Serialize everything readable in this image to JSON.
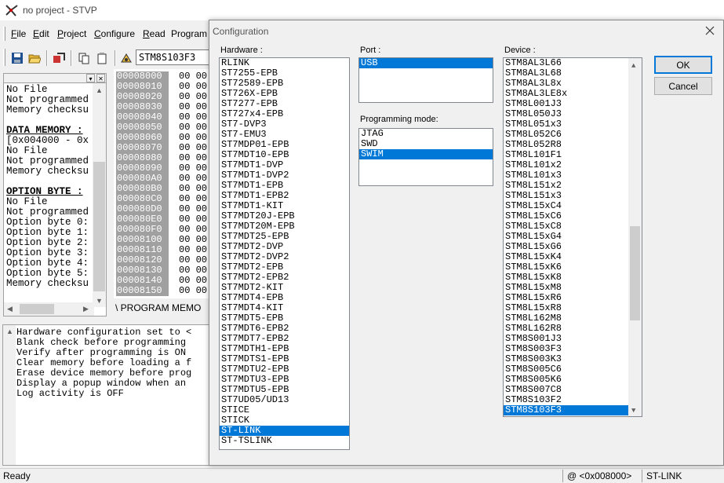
{
  "window": {
    "title": "no project - STVP"
  },
  "menu": {
    "items": [
      {
        "accel": "F",
        "rest": "ile"
      },
      {
        "accel": "E",
        "rest": "dit"
      },
      {
        "accel": "P",
        "rest": "roject"
      },
      {
        "accel": "C",
        "rest": "onfigure"
      },
      {
        "accel": "R",
        "rest": "ead"
      },
      {
        "accel": "",
        "rest": "Program"
      }
    ]
  },
  "toolbar": {
    "device": "STM8S103F3"
  },
  "info_panel": {
    "lines": [
      {
        "text": "No File",
        "bold": false
      },
      {
        "text": "Not programmed",
        "bold": false
      },
      {
        "text": "Memory checksu",
        "bold": false
      },
      {
        "text": "",
        "bold": false
      },
      {
        "text": "DATA MEMORY :",
        "bold": true
      },
      {
        "text": "[0x004000 - 0x",
        "bold": false
      },
      {
        "text": "No File",
        "bold": false
      },
      {
        "text": "Not programmed",
        "bold": false
      },
      {
        "text": "Memory checksu",
        "bold": false
      },
      {
        "text": "",
        "bold": false
      },
      {
        "text": "OPTION BYTE :",
        "bold": true
      },
      {
        "text": "No File",
        "bold": false
      },
      {
        "text": "Not programmed",
        "bold": false
      },
      {
        "text": "Option byte 0:",
        "bold": false
      },
      {
        "text": "Option byte 1:",
        "bold": false
      },
      {
        "text": "Option byte 2:",
        "bold": false
      },
      {
        "text": "Option byte 3:",
        "bold": false
      },
      {
        "text": "Option byte 4:",
        "bold": false
      },
      {
        "text": "Option byte 5:",
        "bold": false
      },
      {
        "text": "Memory checksu",
        "bold": false
      }
    ]
  },
  "memory": {
    "addresses": [
      "00008000",
      "00008010",
      "00008020",
      "00008030",
      "00008040",
      "00008050",
      "00008060",
      "00008070",
      "00008080",
      "00008090",
      "000080A0",
      "000080B0",
      "000080C0",
      "000080D0",
      "000080E0",
      "000080F0",
      "00008100",
      "00008110",
      "00008120",
      "00008130",
      "00008140",
      "00008150"
    ],
    "data": [
      "00 00",
      "00 00",
      "00 00",
      "00 00",
      "00 00",
      "00 00",
      "00 00",
      "00 00",
      "00 00",
      "00 00",
      "00 00",
      "00 00",
      "00 00",
      "00 00",
      "00 00",
      "00 00",
      "00 00",
      "00 00",
      "00 00",
      "00 00",
      "00 00",
      "00 00"
    ],
    "tab_label": "\\ PROGRAM MEMO"
  },
  "log": {
    "lines": [
      "Hardware configuration set to <",
      "Blank check before programming",
      "Verify after programming is ON",
      "Clear memory before loading a f",
      "Erase device memory before prog",
      "Display a popup window when an",
      "Log activity is OFF"
    ]
  },
  "statusbar": {
    "status": "Ready",
    "address": "@ <0x008000>",
    "hardware": "ST-LINK"
  },
  "dialog": {
    "title": "Configuration",
    "hardware_label": "Hardware :",
    "hardware_items": [
      "RLINK",
      "ST7255-EPB",
      "ST72589-EPB",
      "ST726X-EPB",
      "ST7277-EPB",
      "ST727x4-EPB",
      "ST7-DVP3",
      "ST7-EMU3",
      "ST7MDP01-EPB",
      "ST7MDT10-EPB",
      "ST7MDT1-DVP",
      "ST7MDT1-DVP2",
      "ST7MDT1-EPB",
      "ST7MDT1-EPB2",
      "ST7MDT1-KIT",
      "ST7MDT20J-EPB",
      "ST7MDT20M-EPB",
      "ST7MDT25-EPB",
      "ST7MDT2-DVP",
      "ST7MDT2-DVP2",
      "ST7MDT2-EPB",
      "ST7MDT2-EPB2",
      "ST7MDT2-KIT",
      "ST7MDT4-EPB",
      "ST7MDT4-KIT",
      "ST7MDT5-EPB",
      "ST7MDT6-EPB2",
      "ST7MDT7-EPB2",
      "ST7MDTH1-EPB",
      "ST7MDTS1-EPB",
      "ST7MDTU2-EPB",
      "ST7MDTU3-EPB",
      "ST7MDTU5-EPB",
      "ST7UD05/UD13",
      "STICE",
      "STICK",
      "ST-LINK",
      "ST-TSLINK"
    ],
    "hardware_selected": "ST-LINK",
    "port_label": "Port :",
    "port_items": [
      "USB"
    ],
    "port_selected": "USB",
    "mode_label": "Programming mode:",
    "mode_items": [
      "JTAG",
      "SWD",
      "SWIM"
    ],
    "mode_selected": "SWIM",
    "device_label": "Device :",
    "device_items": [
      "STM8AL3L66",
      "STM8AL3L68",
      "STM8AL3L8x",
      "STM8AL3LE8x",
      "STM8L001J3",
      "STM8L050J3",
      "STM8L051x3",
      "STM8L052C6",
      "STM8L052R8",
      "STM8L101F1",
      "STM8L101x2",
      "STM8L101x3",
      "STM8L151x2",
      "STM8L151x3",
      "STM8L15xC4",
      "STM8L15xC6",
      "STM8L15xC8",
      "STM8L15xG4",
      "STM8L15xG6",
      "STM8L15xK4",
      "STM8L15xK6",
      "STM8L15xK8",
      "STM8L15xM8",
      "STM8L15xR6",
      "STM8L15xR8",
      "STM8L162M8",
      "STM8L162R8",
      "STM8S001J3",
      "STM8S003F3",
      "STM8S003K3",
      "STM8S005C6",
      "STM8S005K6",
      "STM8S007C8",
      "STM8S103F2",
      "STM8S103F3"
    ],
    "device_selected": "STM8S103F3",
    "ok_label": "OK",
    "cancel_label": "Cancel"
  },
  "colors": {
    "selection": "#0078d7",
    "memory_address_bg": "#a0a0a0"
  }
}
